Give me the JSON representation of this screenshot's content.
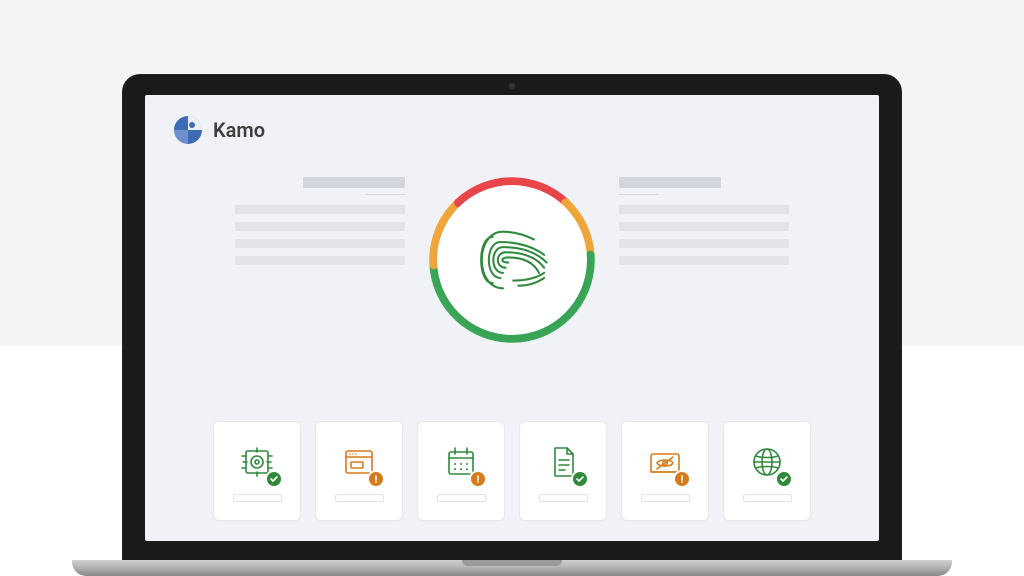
{
  "brand": {
    "name": "Kamo",
    "logo_color": "#3f6ab8"
  },
  "ring": {
    "segments": [
      {
        "color": "#e9464a",
        "fraction": 0.12
      },
      {
        "color": "#f0a63b",
        "fraction": 0.12
      },
      {
        "color": "#3aa657",
        "fraction": 0.5
      },
      {
        "color": "#f0a63b",
        "fraction": 0.14
      },
      {
        "color": "#e9464a",
        "fraction": 0.12
      }
    ]
  },
  "fingerprint_color": "#2f8a3c",
  "cards": [
    {
      "icon": "target",
      "icon_color": "#2f8a3c",
      "status": "ok"
    },
    {
      "icon": "browser",
      "icon_color": "#d77a1a",
      "status": "warn"
    },
    {
      "icon": "calendar",
      "icon_color": "#2f8a3c",
      "status": "warn"
    },
    {
      "icon": "document",
      "icon_color": "#2f8a3c",
      "status": "ok"
    },
    {
      "icon": "eye-off",
      "icon_color": "#d77a1a",
      "status": "warn"
    },
    {
      "icon": "globe",
      "icon_color": "#2f8a3c",
      "status": "ok"
    }
  ],
  "status_colors": {
    "ok": "#2f8a3c",
    "warn": "#d77a1a"
  }
}
